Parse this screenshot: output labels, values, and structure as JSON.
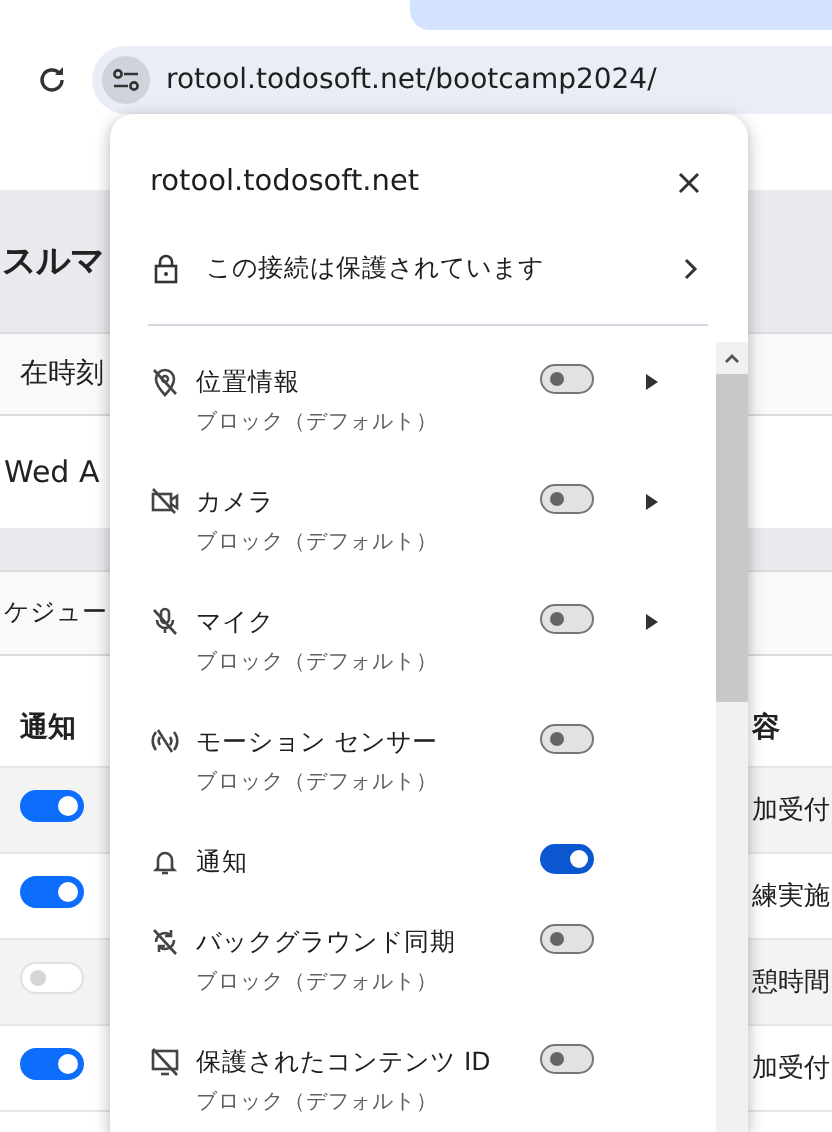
{
  "browser": {
    "url": "rotool.todosoft.net/bootcamp2024/"
  },
  "page": {
    "heading": "スルマ",
    "current_time_label": "在時刻",
    "current_time_value": "Wed A",
    "schedule_label": "ケジュー",
    "table": {
      "columns": [
        "通知",
        "容"
      ],
      "rows": [
        {
          "notify": true,
          "content": "加受付"
        },
        {
          "notify": true,
          "content": "練実施"
        },
        {
          "notify": false,
          "content": "憩時間"
        },
        {
          "notify": true,
          "content": "加受付"
        }
      ]
    }
  },
  "popup": {
    "title": "rotool.todosoft.net",
    "connection": "この接続は保護されています",
    "permissions": [
      {
        "kind": "location",
        "label": "位置情報",
        "status": "ブロック（デフォルト）",
        "on": false,
        "submenu": true
      },
      {
        "kind": "camera",
        "label": "カメラ",
        "status": "ブロック（デフォルト）",
        "on": false,
        "submenu": true
      },
      {
        "kind": "microphone",
        "label": "マイク",
        "status": "ブロック（デフォルト）",
        "on": false,
        "submenu": true
      },
      {
        "kind": "motion",
        "label": "モーション センサー",
        "status": "ブロック（デフォルト）",
        "on": false,
        "submenu": false
      },
      {
        "kind": "notifications",
        "label": "通知",
        "on": true,
        "submenu": false
      },
      {
        "kind": "sync",
        "label": "バックグラウンド同期",
        "status": "ブロック（デフォルト）",
        "on": false,
        "submenu": false
      },
      {
        "kind": "content",
        "label": "保護されたコンテンツ ID",
        "status": "ブロック（デフォルト）",
        "on": false,
        "submenu": false
      }
    ]
  }
}
